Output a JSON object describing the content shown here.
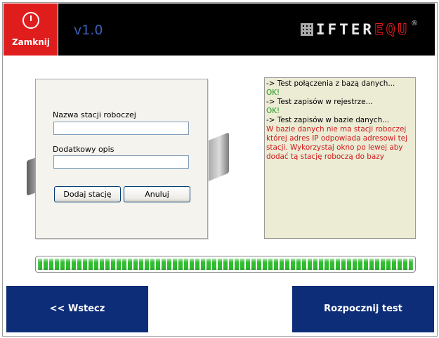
{
  "header": {
    "close_label": "Zamknij",
    "version": "v1.0",
    "logo_part1": "IFTER",
    "logo_part2": "EQU",
    "logo_mark": "®",
    "close_icon": "power-icon"
  },
  "form": {
    "station_name_label": "Nazwa stacji roboczej",
    "station_name_value": "",
    "description_label": "Dodatkowy opis",
    "description_value": "",
    "add_button": "Dodaj stację",
    "cancel_button": "Anuluj"
  },
  "log": [
    {
      "text": "-> Test połączenia z bazą danych...",
      "color": "#000000"
    },
    {
      "text": "OK!",
      "color": "#1f9a1f"
    },
    {
      "text": "-> Test zapisów w rejestrze...",
      "color": "#000000"
    },
    {
      "text": "OK!",
      "color": "#1f9a1f"
    },
    {
      "text": "-> Test zapisów w bazie danych...",
      "color": "#000000"
    },
    {
      "text": "W bazie danych nie ma stacji roboczej której adres IP odpowiada adresowi tej stacji. Wykorzystaj okno po lewej aby dodać tą stację roboczą do bazy",
      "color": "#cc1a1a"
    }
  ],
  "progress": {
    "value": 1.0
  },
  "nav": {
    "back_label": "<< Wstecz",
    "start_label": "Rozpocznij test"
  },
  "colors": {
    "header_bg": "#000000",
    "close_bg": "#e01d1d",
    "nav_bg": "#0e2d78",
    "log_bg": "#ecebd4",
    "progress_green": "#2fbd2f"
  }
}
